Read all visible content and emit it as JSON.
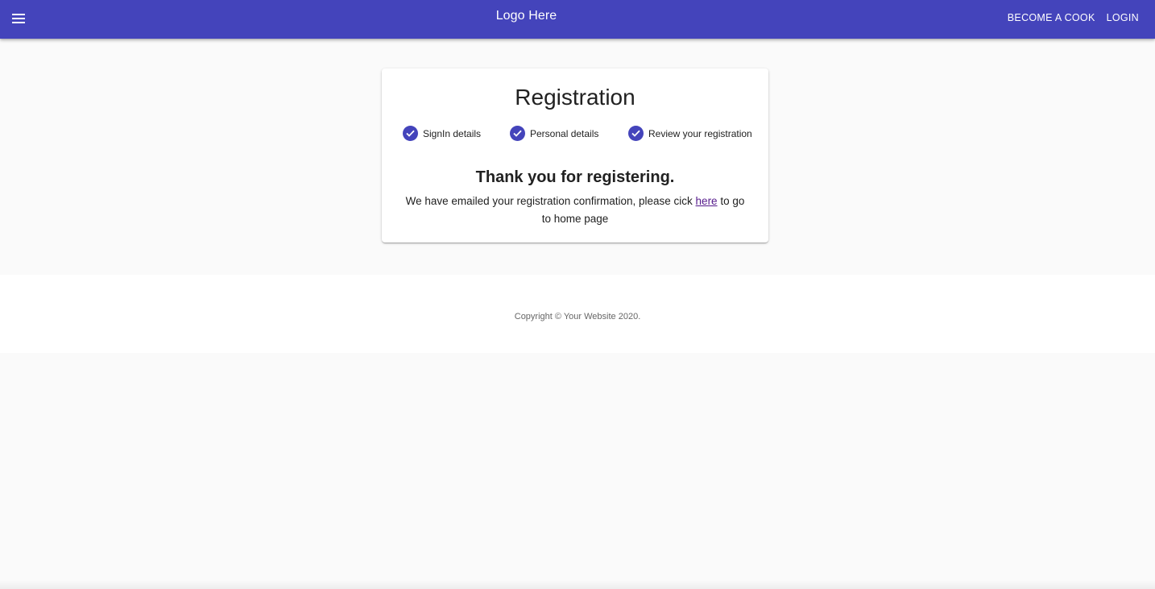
{
  "colors": {
    "primary": "#4444bb",
    "background": "#fafafa",
    "link_visited": "#551a8b"
  },
  "header": {
    "menu_icon": "hamburger-menu-icon",
    "logo_text": "Logo Here",
    "actions": [
      "BECOME A COOK",
      "LOGIN"
    ]
  },
  "registration": {
    "title": "Registration",
    "steps": [
      {
        "label": "SignIn details",
        "icon": "check-circle-icon"
      },
      {
        "label": "Personal details",
        "icon": "check-circle-icon"
      },
      {
        "label": "Review your registration",
        "icon": "check-circle-icon"
      }
    ],
    "thanks_heading": "Thank you for registering.",
    "message_before": "We have emailed your registration confirmation, please cick ",
    "message_link": "here",
    "message_after": " to go to home page"
  },
  "footer": {
    "copyright": "Copyright © Your Website 2020."
  }
}
